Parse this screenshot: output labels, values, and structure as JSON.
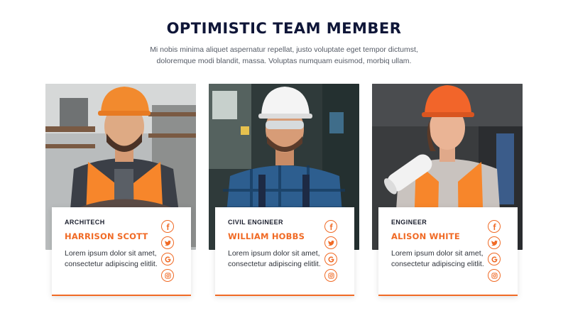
{
  "header": {
    "title": "OPTIMISTIC TEAM MEMBER",
    "subtitle": "Mi nobis minima aliquet aspernatur repellat, justo voluptate eget tempor dictumst, doloremque modi blandit, massa. Voluptas numquam euismod, morbiq ullam."
  },
  "team": [
    {
      "role": "ARCHITECH",
      "name": "HARRISON SCOTT",
      "bio": "Lorem ipsum dolor sit amet, consectetur adipiscing elitlit.",
      "helmet_color": "#f28a2e",
      "socials": [
        "facebook-icon",
        "twitter-icon",
        "google-icon",
        "instagram-icon"
      ]
    },
    {
      "role": "CIVIL ENGINEER",
      "name": "WILLIAM HOBBS",
      "bio": "Lorem ipsum dolor sit amet, consectetur adipiscing elitlit.",
      "helmet_color": "#f4f4f4",
      "socials": [
        "facebook-icon",
        "twitter-icon",
        "google-icon",
        "instagram-icon"
      ]
    },
    {
      "role": "ENGINEER",
      "name": "ALISON WHITE",
      "bio": "Lorem ipsum dolor sit amet, consectetur adipiscing elitlit.",
      "helmet_color": "#f2652a",
      "socials": [
        "facebook-icon",
        "twitter-icon",
        "google-icon",
        "instagram-icon"
      ]
    }
  ],
  "colors": {
    "accent": "#f06a25",
    "title": "#0f1638",
    "vest": "#f7862b"
  }
}
